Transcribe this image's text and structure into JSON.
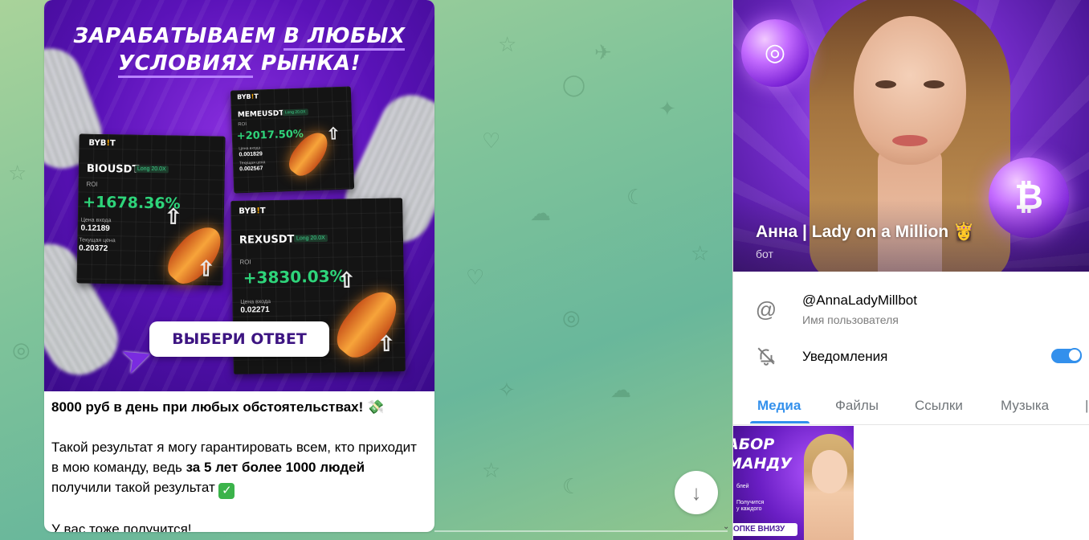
{
  "promo": {
    "headline_line1_part1": "ЗАРАБАТЫВАЕМ",
    "headline_line1_part2": "В ЛЮБЫХ",
    "headline_line2_part1": "УСЛОВИЯХ",
    "headline_line2_part2": "РЫНКА!",
    "cards": [
      {
        "brand": "BYB",
        "brand_accent": "!",
        "brand_end": "T",
        "pair": "BIOUSDT",
        "tag": "Long 20.0X",
        "roi_label": "ROI",
        "roi": "+1678.36%",
        "entry_label": "Цена входа",
        "entry": "0.12189",
        "current_label": "Текущая цена",
        "current": "0.20372"
      },
      {
        "brand": "BYB",
        "brand_accent": "!",
        "brand_end": "T",
        "pair": "MEMEUSDT",
        "tag": "Long 20.0X",
        "roi_label": "ROI",
        "roi": "+2017.50%",
        "entry_label": "Цена входа",
        "entry": "0.001829",
        "current_label": "Текущая цена",
        "current": "0.002567"
      },
      {
        "brand": "BYB",
        "brand_accent": "!",
        "brand_end": "T",
        "pair": "REXUSDT",
        "tag": "Long 20.0X",
        "roi_label": "ROI",
        "roi": "+3830.03%",
        "entry_label": "Цена входа",
        "entry": "0.02271"
      }
    ],
    "cta": "ВЫБЕРИ ОТВЕТ"
  },
  "message": {
    "line1": "8000 руб в день при любых обстоятельствах!",
    "p2_a": "Такой результат я могу гарантировать всем, кто приходит в мою команду, ведь ",
    "p2_bold1": "за 5 лет более 1000 людей",
    "p2_b": " получили такой результат",
    "p3": "У вас тоже получится!"
  },
  "profile": {
    "name": "Анна | Lady on a Million",
    "type": "бот",
    "username": "@AnnaLadyMillbot",
    "username_label": "Имя пользователя",
    "notifications_label": "Уведомления",
    "notifications_on": true
  },
  "tabs": [
    "Медиа",
    "Файлы",
    "Ссылки",
    "Музыка"
  ],
  "thumb": {
    "line1": "АБОР",
    "line2": "МАНДУ",
    "small1": "блей",
    "small2": "Получится",
    "small3": "у каждого",
    "button": "ОПКЕ ВНИЗУ"
  },
  "colors": {
    "accent": "#3390ec",
    "promo_purple": "#5a12b8",
    "roi_green": "#2ed47a"
  }
}
